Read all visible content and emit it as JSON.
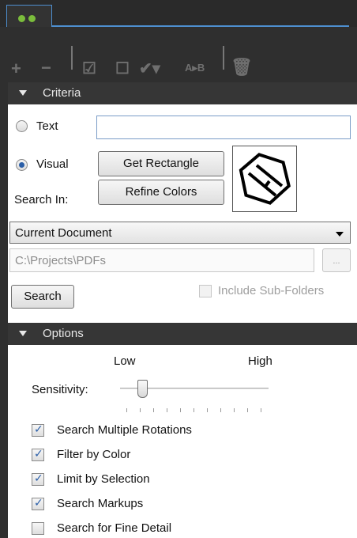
{
  "tabs": [
    {
      "icon": "binoculars-icon"
    }
  ],
  "toolbar": {
    "items": [
      {
        "icon": "plus-icon",
        "glyph": "+"
      },
      {
        "icon": "minus-icon",
        "glyph": "−"
      },
      {
        "icon": "check-box-icon",
        "glyph": "☑"
      },
      {
        "icon": "uncheck-box-icon",
        "glyph": "☐"
      },
      {
        "icon": "checkmark-dropdown-icon",
        "glyph": "✔▾"
      },
      {
        "icon": "replace-ab-icon",
        "glyph": "A▸B"
      },
      {
        "icon": "trash-icon",
        "glyph": "🗑"
      }
    ]
  },
  "criteria": {
    "title": "Criteria",
    "text_label": "Text",
    "text_value": "",
    "visual_label": "Visual",
    "get_rectangle": "Get Rectangle",
    "refine_colors": "Refine Colors",
    "search_in_label": "Search In:",
    "search_in_value": "Current Document",
    "path_value": "C:\\Projects\\PDFs",
    "browse_label": "...",
    "include_subfolders": "Include Sub-Folders",
    "search_button": "Search",
    "selected_mode": "Visual"
  },
  "options": {
    "title": "Options",
    "low_label": "Low",
    "high_label": "High",
    "sensitivity_label": "Sensitivity:",
    "sensitivity_value": 0.15,
    "checks": [
      {
        "label": "Search Multiple Rotations",
        "checked": true
      },
      {
        "label": "Filter by Color",
        "checked": true
      },
      {
        "label": "Limit by Selection",
        "checked": true
      },
      {
        "label": "Search Markups",
        "checked": true
      },
      {
        "label": "Search for Fine Detail",
        "checked": false
      }
    ]
  },
  "colors": {
    "accent": "#4e8fd0",
    "panel_dark": "#2f2f2f",
    "header": "#363636",
    "brand_green": "#7bbd3c"
  }
}
